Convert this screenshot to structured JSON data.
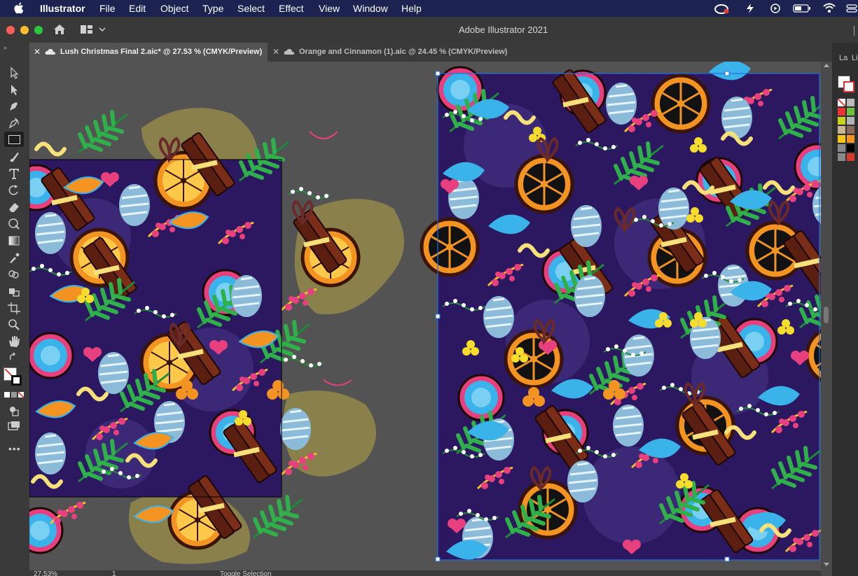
{
  "menubar": {
    "apple_icon": "apple-icon",
    "app_name": "Illustrator",
    "items": [
      "File",
      "Edit",
      "Object",
      "Type",
      "Select",
      "Effect",
      "View",
      "Window",
      "Help"
    ],
    "status_icons": [
      "creative-cloud-icon",
      "adobe-icon",
      "play-icon",
      "battery-icon",
      "wifi-icon",
      "control-center-icon"
    ]
  },
  "window": {
    "title": "Adobe Illustrator 2021",
    "home_icon": "home-icon",
    "workspace_icon": "workspace-switcher-icon"
  },
  "tabs": [
    {
      "label": "Lush Christmas Final 2.aic* @ 27.53 % (CMYK/Preview)",
      "active": true
    },
    {
      "label": "Orange and Cinnamon (1).aic @ 24.45 % (CMYK/Preview)",
      "active": false
    }
  ],
  "tools": [
    "selection-tool",
    "direct-selection-tool",
    "pen-tool",
    "curvature-tool",
    "rectangle-tool",
    "paintbrush-tool",
    "type-tool",
    "rotate-tool",
    "eraser-tool",
    "warp-tool",
    "gradient-tool",
    "eyedropper-tool",
    "shape-builder-tool",
    "live-paint-tool",
    "artboard-tool",
    "zoom-tool",
    "hand-tool",
    "rotate-view-tool",
    "fill-stroke",
    "color-mode",
    "draw-mode",
    "screen-mode",
    "edit-toolbar"
  ],
  "right_panel": {
    "labels": [
      "La",
      "Li"
    ]
  },
  "status": {
    "zoom": "27.53%",
    "page": "1",
    "tool": "Toggle Selection"
  },
  "colors": {
    "menubar": "#1c2350",
    "pattern_bg": "#2b1860",
    "orange": "#f39322",
    "pink": "#e8407f",
    "green": "#2fa84a",
    "blue": "#3ab2ea",
    "selection": "#1e6fe0",
    "blob": "#8a804c"
  }
}
